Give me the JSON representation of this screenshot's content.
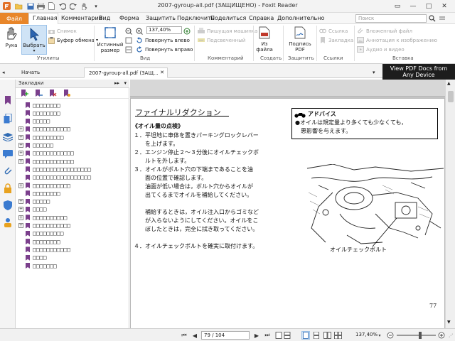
{
  "window": {
    "title": "2007-gyroup-all.pdf (ЗАЩИЩЕНО) - Foxit Reader"
  },
  "menu": {
    "file": "Файл",
    "items": [
      "Главная",
      "Комментарий",
      "Вид",
      "Форма",
      "Защитить",
      "Подключить",
      "Поделиться",
      "Справка",
      "Дополнительно"
    ],
    "search_placeholder": "Поиск"
  },
  "ribbon": {
    "hand": "Рука",
    "select": "Выбрать",
    "snapshot": "Снимок",
    "clipboard": "Буфер обмена",
    "actual_size_1": "Истинный",
    "actual_size_2": "размер",
    "zoom_value": "137,40%",
    "rotate_left": "Повернуть влево",
    "rotate_right": "Повернуть вправо",
    "typewriter": "Пишущая машинка",
    "highlight": "Подсвеченный",
    "from_file_1": "Из",
    "from_file_2": "файла",
    "sign_1": "Подпись",
    "sign_2": "PDF",
    "link": "Ссылка",
    "bookmark": "Закладка",
    "attach_file": "Вложенный файл",
    "image_annotation": "Аннотация к изображению",
    "audio_video": "Аудио и видео",
    "groups": [
      "Утилиты",
      "Вид",
      "Комментарий",
      "Создать",
      "Защитить",
      "Ссылки",
      "Вставка"
    ]
  },
  "promo": {
    "line1": "View PDF Docs from",
    "line2": "Any Device"
  },
  "tabs": {
    "start": "Начать",
    "doc": "2007-gyroup-all.pdf (ЗАЩ..."
  },
  "bookmarks": {
    "header": "Закладки",
    "items": [
      {
        "label": "□□□□□□□□",
        "expandable": false
      },
      {
        "label": "□□□□□□□□",
        "expandable": false
      },
      {
        "label": "□□□□□",
        "expandable": false
      },
      {
        "label": "□□□□□□□□□□□",
        "expandable": true
      },
      {
        "label": "□□□□□□□□□",
        "expandable": true
      },
      {
        "label": "□□□□□□",
        "expandable": true
      },
      {
        "label": "□□□□□□□□□□□□",
        "expandable": true
      },
      {
        "label": "□□□□□□□□□□□□",
        "expandable": true
      },
      {
        "label": "□□□□□□□□□□□□□□□□□",
        "expandable": false
      },
      {
        "label": "□□□□□□□□□□□□□□□□□",
        "expandable": false
      },
      {
        "label": "□□□□□□□□□□□",
        "expandable": true
      },
      {
        "label": "□□□□□□□□",
        "expandable": false
      },
      {
        "label": "□□□□□",
        "expandable": true
      },
      {
        "label": "□□□□",
        "expandable": true
      },
      {
        "label": "□□□□□□□□□□",
        "expandable": true
      },
      {
        "label": "□□□□□□□□□□□",
        "expandable": true
      },
      {
        "label": "□□□□□□□□□",
        "expandable": false
      },
      {
        "label": "□□□□□□□□",
        "expandable": false
      },
      {
        "label": "□□□□□□□□□□□",
        "expandable": false
      },
      {
        "label": "□□□□",
        "expandable": false
      },
      {
        "label": "□□□□□□□",
        "expandable": false
      }
    ]
  },
  "document": {
    "title": "ファイナルリダクション",
    "section": "《オイル量の点検》",
    "lines": [
      "１．平坦地に車体を置きパーキングロックレバー",
      "　　を上げます。",
      "２．エンジン停止２～３分後にオイルチェックボ",
      "　　ルトを外します。",
      "３．オイルがボルト穴の下端まであることを油",
      "　　面の位置で確認します。",
      "　　油面が低い場合は，ボルト穴からオイルが",
      "　　出てくるまでオイルを補給してください。",
      "",
      "　　補給するときは，オイル注入口からゴミなど",
      "　　が入らないようにしてください。オイルをこ",
      "　　ぼしたときは，完全に拭き取ってください。",
      "",
      "４．オイルチェックボルトを確実に取付けます。"
    ],
    "advice_title": "アドバイス",
    "advice_line1": "●オイルは規定量より多くても少なくても，",
    "advice_line2": "　悪影響を与えます。",
    "figure_caption": "オイルチェックボルト",
    "page_number": "77"
  },
  "status": {
    "page": "79 / 104",
    "zoom": "137,40%"
  }
}
